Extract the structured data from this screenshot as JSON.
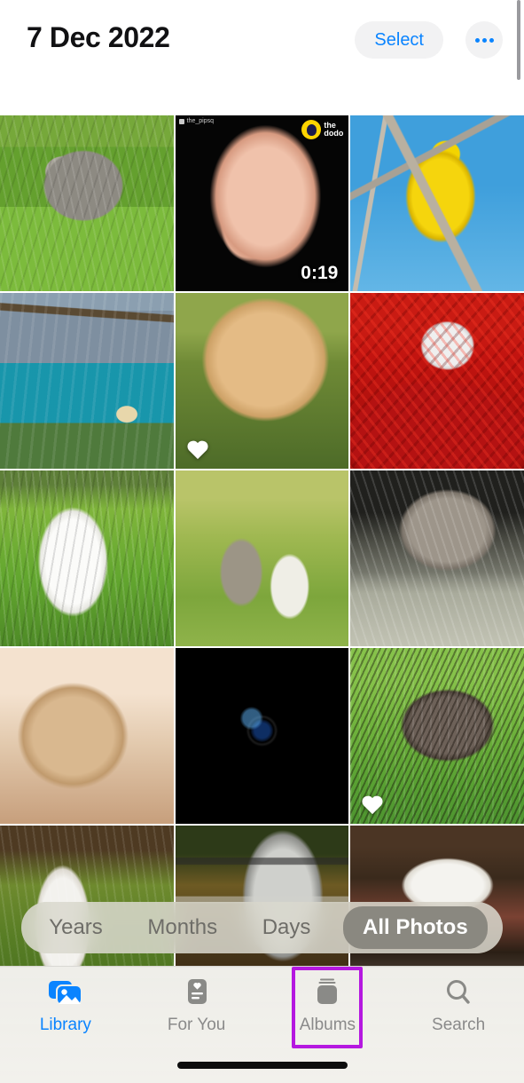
{
  "header": {
    "title": "7 Dec 2022",
    "select_label": "Select",
    "more_icon": "ellipsis-icon",
    "accent_color": "#0a84ff",
    "button_bg": "#f2f2f3"
  },
  "scrollbar": {
    "name": "scroll-indicator"
  },
  "grid": {
    "columns": 3,
    "photos": [
      {
        "id": 1,
        "subject": "Tabby kitten walking in grass",
        "art": "art-kitten-grass",
        "favorite": false,
        "is_video": false,
        "duration": ""
      },
      {
        "id": 2,
        "subject": "Hand holding newborn rodent (video)",
        "art": "art-hand-dark",
        "favorite": false,
        "is_video": true,
        "duration": "0:19",
        "watermark": "the dodo",
        "handle": "the_pipsq"
      },
      {
        "id": 3,
        "subject": "Yellow canary perched on branch",
        "art": "art-yellow-bird",
        "favorite": false,
        "is_video": false,
        "duration": ""
      },
      {
        "id": 4,
        "subject": "Dog beside turquoise alpine lake",
        "art": "art-lake-dog",
        "favorite": false,
        "is_video": false,
        "duration": ""
      },
      {
        "id": 5,
        "subject": "Golden retriever puppy lying on grass",
        "art": "art-golden-puppy",
        "favorite": true,
        "is_video": false,
        "duration": ""
      },
      {
        "id": 6,
        "subject": "White dog in red autumn foliage",
        "art": "art-red-foliage",
        "favorite": false,
        "is_video": false,
        "duration": ""
      },
      {
        "id": 7,
        "subject": "Samoyed dog running through tall grass",
        "art": "art-samoyed",
        "favorite": false,
        "is_video": false,
        "duration": ""
      },
      {
        "id": 8,
        "subject": "Two kittens, one looking up",
        "art": "art-two-kittens",
        "favorite": false,
        "is_video": false,
        "duration": ""
      },
      {
        "id": 9,
        "subject": "Tabby cat crouching in dry grass",
        "art": "art-tabby-crouch",
        "favorite": false,
        "is_video": false,
        "duration": ""
      },
      {
        "id": 10,
        "subject": "French bulldog resting on floor",
        "art": "art-frenchie",
        "favorite": false,
        "is_video": false,
        "duration": ""
      },
      {
        "id": 11,
        "subject": "Camera lens on colourful mosaic",
        "art": "art-camera-lens",
        "favorite": false,
        "is_video": false,
        "duration": ""
      },
      {
        "id": 12,
        "subject": "Hedgehog foraging in green grass",
        "art": "art-hedgehog",
        "favorite": true,
        "is_video": false,
        "duration": ""
      },
      {
        "id": 13,
        "subject": "Small white dog in grass",
        "art": "art-white-dog-crop",
        "favorite": false,
        "is_video": false,
        "duration": ""
      },
      {
        "id": 14,
        "subject": "Vintage camera lens close-up",
        "art": "art-vintage-lens",
        "favorite": false,
        "is_video": false,
        "duration": ""
      },
      {
        "id": 15,
        "subject": "White cat lying on wooden shelf",
        "art": "art-cat-shelf",
        "favorite": false,
        "is_video": false,
        "duration": ""
      }
    ]
  },
  "segmented_control": {
    "options": [
      {
        "label": "Years",
        "selected": false
      },
      {
        "label": "Months",
        "selected": false
      },
      {
        "label": "Days",
        "selected": false
      },
      {
        "label": "All Photos",
        "selected": true
      }
    ]
  },
  "tabbar": {
    "tabs": [
      {
        "label": "Library",
        "icon": "photo-stack-icon",
        "active": true,
        "highlighted": false
      },
      {
        "label": "For You",
        "icon": "for-you-card-icon",
        "active": false,
        "highlighted": false
      },
      {
        "label": "Albums",
        "icon": "albums-stack-icon",
        "active": false,
        "highlighted": true
      },
      {
        "label": "Search",
        "icon": "magnifier-icon",
        "active": false,
        "highlighted": false
      }
    ],
    "highlight_color": "#b518e0"
  },
  "home_indicator": {
    "name": "home-indicator"
  }
}
